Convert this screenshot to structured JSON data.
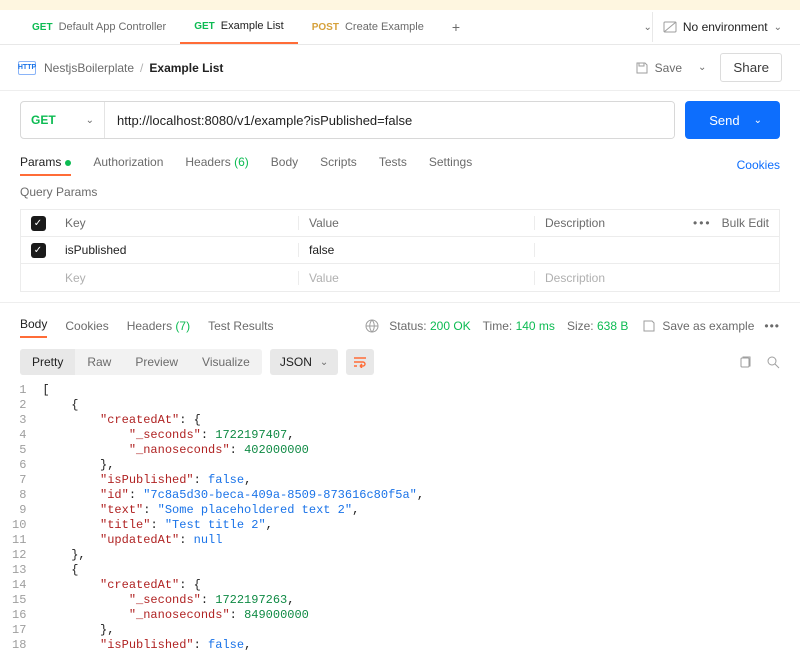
{
  "tabs": {
    "items": [
      {
        "method": "GET",
        "label": "Default App Controller"
      },
      {
        "method": "GET",
        "label": "Example List"
      },
      {
        "method": "POST",
        "label": "Create Example"
      }
    ],
    "env_label": "No environment"
  },
  "breadcrumb": {
    "http_badge": "HTTP",
    "collection": "NestjsBoilerplate",
    "name": "Example List",
    "save_label": "Save",
    "share_label": "Share"
  },
  "request": {
    "method": "GET",
    "url": "http://localhost:8080/v1/example?isPublished=false",
    "send_label": "Send",
    "subtabs": {
      "params": "Params",
      "authorization": "Authorization",
      "headers_label": "Headers",
      "headers_count": "(6)",
      "body": "Body",
      "scripts": "Scripts",
      "tests": "Tests",
      "settings": "Settings",
      "cookies": "Cookies"
    }
  },
  "params": {
    "section_label": "Query Params",
    "columns": {
      "key": "Key",
      "value": "Value",
      "description": "Description"
    },
    "bulk_edit": "Bulk Edit",
    "rows": [
      {
        "checked": true,
        "key": "isPublished",
        "value": "false",
        "description": ""
      }
    ],
    "placeholders": {
      "key": "Key",
      "value": "Value",
      "description": "Description"
    }
  },
  "response": {
    "tabs": {
      "body": "Body",
      "cookies": "Cookies",
      "headers_label": "Headers",
      "headers_count": "(7)",
      "test_results": "Test Results"
    },
    "status_label": "Status:",
    "status_value": "200 OK",
    "time_label": "Time:",
    "time_value": "140 ms",
    "size_label": "Size:",
    "size_value": "638 B",
    "save_example": "Save as example",
    "view_modes": {
      "pretty": "Pretty",
      "raw": "Raw",
      "preview": "Preview",
      "visualize": "Visualize"
    },
    "format": "JSON",
    "json": [
      {
        "createdAt": {
          "_seconds": 1722197407,
          "_nanoseconds": 402000000
        },
        "isPublished": false,
        "id": "7c8a5d30-beca-409a-8509-873616c80f5a",
        "text": "Some placeholdered text 2",
        "title": "Test title 2",
        "updatedAt": null
      },
      {
        "createdAt": {
          "_seconds": 1722197263,
          "_nanoseconds": 849000000
        },
        "isPublished": false
      }
    ]
  }
}
